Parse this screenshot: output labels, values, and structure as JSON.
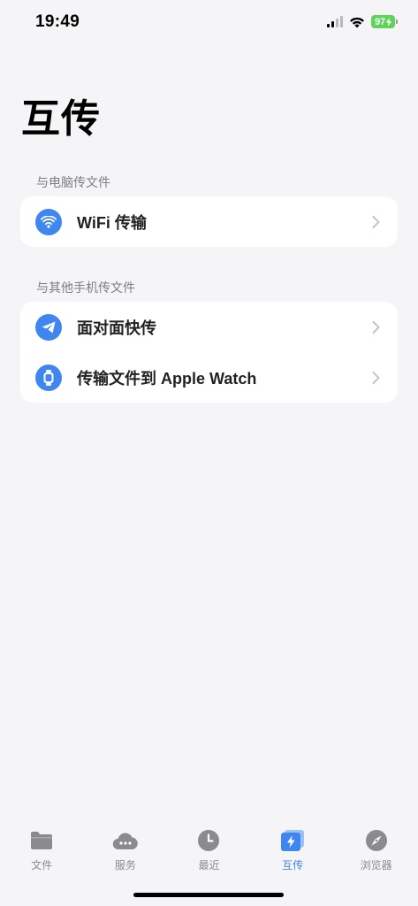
{
  "status": {
    "time": "19:49",
    "battery": "97"
  },
  "page": {
    "title": "互传"
  },
  "sections": [
    {
      "header": "与电脑传文件",
      "items": [
        {
          "label": "WiFi 传输",
          "icon": "wifi-icon"
        }
      ]
    },
    {
      "header": "与其他手机传文件",
      "items": [
        {
          "label": "面对面快传",
          "icon": "paper-plane-icon"
        },
        {
          "label": "传输文件到 Apple Watch",
          "icon": "watch-icon"
        }
      ]
    }
  ],
  "tabs": [
    {
      "label": "文件",
      "icon": "folder-icon",
      "active": false
    },
    {
      "label": "服务",
      "icon": "cloud-icon",
      "active": false
    },
    {
      "label": "最近",
      "icon": "clock-icon",
      "active": false
    },
    {
      "label": "互传",
      "icon": "transfer-bolt-icon",
      "active": true
    },
    {
      "label": "浏览器",
      "icon": "compass-icon",
      "active": false
    }
  ],
  "colors": {
    "accent": "#3f86f0",
    "background": "#f5f5f7",
    "battery": "#5fd35a"
  }
}
